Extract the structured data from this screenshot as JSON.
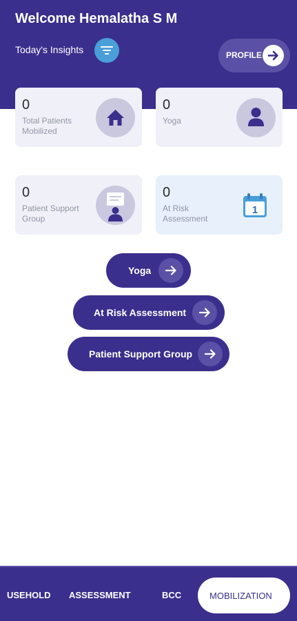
{
  "header": {
    "welcome": "Welcome Hemalatha S M",
    "insights_label": "Today's Insights",
    "profile_label": "PROFILE"
  },
  "cards": [
    {
      "count": "0",
      "label": "Total Patients Mobilized",
      "icon": "home-icon"
    },
    {
      "count": "0",
      "label": "Yoga",
      "icon": "person-icon"
    },
    {
      "count": "0",
      "label": "Patient Support Group",
      "icon": "speech-person-icon"
    },
    {
      "count": "0",
      "label": "At Risk Assessment",
      "icon": "calendar-icon"
    }
  ],
  "calendar_day": "1",
  "actions": [
    {
      "label": "Yoga"
    },
    {
      "label": "At Risk Assessment"
    },
    {
      "label": "Patient Support Group"
    }
  ],
  "tabs": [
    {
      "label": "USEHOLD"
    },
    {
      "label": "ASSESSMENT"
    },
    {
      "label": "BCC"
    },
    {
      "label": "MOBILIZATION",
      "active": true
    }
  ],
  "colors": {
    "primary": "#3a2f8c",
    "accent": "#5a51a6",
    "filter_button": "#4a9fd8",
    "card_background": "#f0f1f8",
    "muted_text": "#9094a6"
  }
}
